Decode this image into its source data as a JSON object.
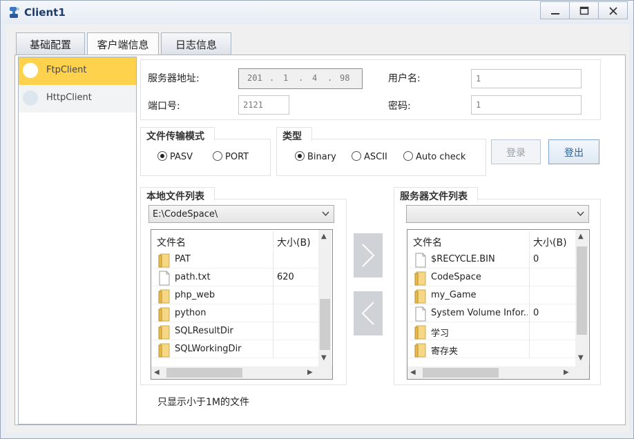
{
  "window": {
    "title": "Client1",
    "minimize_label": "—",
    "close_label": "X"
  },
  "tabs": [
    {
      "label": "基础配置"
    },
    {
      "label": "客户端信息"
    },
    {
      "label": "日志信息"
    }
  ],
  "sidebar": {
    "items": [
      {
        "label": "FtpClient"
      },
      {
        "label": "HttpClient"
      }
    ]
  },
  "connection": {
    "server_label": "服务器地址:",
    "server_ip": [
      "201",
      "1",
      "4",
      "98"
    ],
    "port_label": "端口号:",
    "port_value": "2121",
    "username_label": "用户名:",
    "username_value": "1",
    "password_label": "密码:",
    "password_value": "1"
  },
  "transfer_mode": {
    "title": "文件传输模式",
    "options": [
      "PASV",
      "PORT"
    ],
    "selected": "PASV"
  },
  "type": {
    "title": "类型",
    "options": [
      "Binary",
      "ASCII",
      "Auto check"
    ],
    "selected": "Binary"
  },
  "buttons": {
    "login": "登录",
    "logout": "登出"
  },
  "local": {
    "title": "本地文件列表",
    "path": "E:\\CodeSpace\\",
    "columns": {
      "name": "文件名",
      "size": "大小(B)"
    },
    "rows": [
      {
        "name": "PAT",
        "size": "",
        "kind": "folder"
      },
      {
        "name": "path.txt",
        "size": "620",
        "kind": "file"
      },
      {
        "name": "php_web",
        "size": "",
        "kind": "folder"
      },
      {
        "name": "python",
        "size": "",
        "kind": "folder"
      },
      {
        "name": "SQLResultDir",
        "size": "",
        "kind": "folder"
      },
      {
        "name": "SQLWorkingDir",
        "size": "",
        "kind": "folder"
      }
    ]
  },
  "server": {
    "title": "服务器文件列表",
    "path": "",
    "columns": {
      "name": "文件名",
      "size": "大小(B)"
    },
    "rows": [
      {
        "name": "$RECYCLE.BIN",
        "size": "0",
        "kind": "file"
      },
      {
        "name": "CodeSpace",
        "size": "",
        "kind": "folder"
      },
      {
        "name": "my_Game",
        "size": "",
        "kind": "folder"
      },
      {
        "name": "System Volume Infor...",
        "size": "0",
        "kind": "file"
      },
      {
        "name": "学习",
        "size": "",
        "kind": "folder"
      },
      {
        "name": "寄存夹",
        "size": "",
        "kind": "folder"
      }
    ]
  },
  "note": "只显示小于1M的文件",
  "colors": {
    "selected_item": "#ffd24d",
    "accent": "#2d5f96"
  }
}
